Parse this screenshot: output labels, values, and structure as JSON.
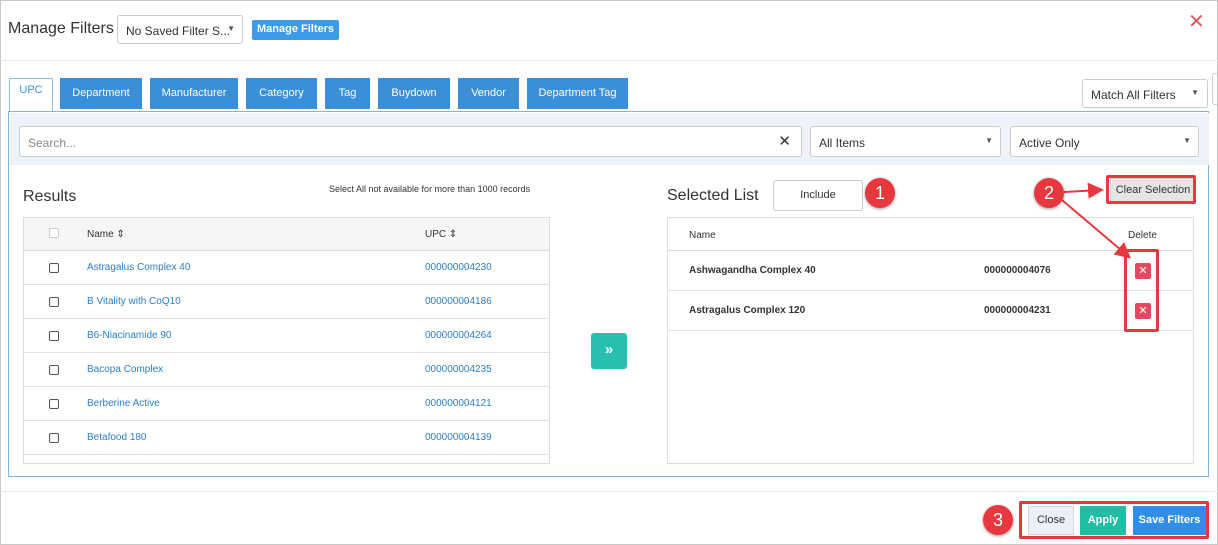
{
  "header": {
    "title": "Manage Filters",
    "saved_filter": "No Saved Filter S...",
    "manage_btn": "Manage Filters",
    "close_icon": "✕"
  },
  "tabs": [
    "UPC",
    "Department",
    "Manufacturer",
    "Category",
    "Tag",
    "Buydown",
    "Vendor",
    "Department Tag"
  ],
  "match_select": "Match All Filters",
  "filters": {
    "search_placeholder": "Search...",
    "items_select": "All Items",
    "status_select": "Active Only"
  },
  "results": {
    "title": "Results",
    "note": "Select All not available for more than 1000 records",
    "col_name": "Name ⇕",
    "col_upc": "UPC ⇕",
    "rows": [
      {
        "name": "Astragalus Complex 40",
        "upc": "000000004230"
      },
      {
        "name": "B Vitality with CoQ10",
        "upc": "000000004186"
      },
      {
        "name": "B6-Niacinamide 90",
        "upc": "000000004264"
      },
      {
        "name": "Bacopa Complex",
        "upc": "000000004235"
      },
      {
        "name": "Berberine Active",
        "upc": "000000004121"
      },
      {
        "name": "Betafood 180",
        "upc": "000000004139"
      }
    ]
  },
  "move_btn": "»",
  "selected": {
    "title": "Selected List",
    "include_btn": "Include",
    "clear_btn": "Clear Selection",
    "col_name": "Name",
    "col_delete": "Delete",
    "rows": [
      {
        "name": "Ashwagandha Complex 40",
        "upc": "000000004076"
      },
      {
        "name": "Astragalus Complex 120",
        "upc": "000000004231"
      }
    ]
  },
  "footer": {
    "close": "Close",
    "apply": "Apply",
    "save": "Save Filters"
  },
  "callouts": [
    "1",
    "2",
    "3"
  ],
  "colors": {
    "accent": "#3b8fd9",
    "apply": "#20bfa4",
    "delete": "#e8475e",
    "callout": "#e8383f"
  }
}
